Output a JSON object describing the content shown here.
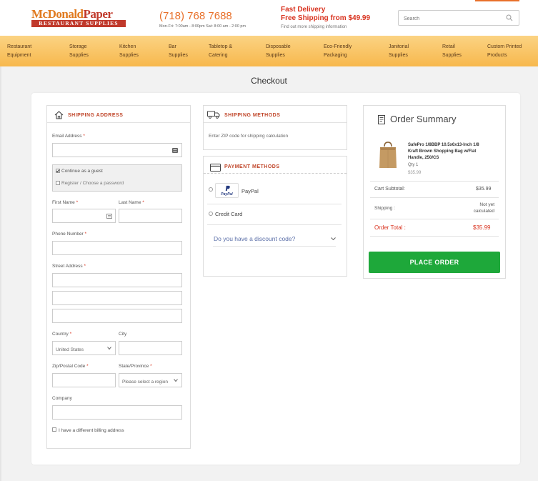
{
  "header": {
    "logo_top_left": "McDonald",
    "logo_top_right": "Paper",
    "logo_bottom": "RESTAURANT SUPPLIES",
    "phone": "(718) 768 7688",
    "hours": "Mon-Fri: 7:00am - 8:00pm Sat: 8:00 am - 2:00 pm",
    "fast_delivery": "Fast Delivery",
    "free_shipping": "Free Shipping from $49.99",
    "find_out": "Find out more shipping information",
    "search_placeholder": "Search"
  },
  "nav": [
    {
      "line1": "Restaurant",
      "line2": "Equipment"
    },
    {
      "line1": "Storage",
      "line2": "Supplies"
    },
    {
      "line1": "Kitchen",
      "line2": "Supplies"
    },
    {
      "line1": "Bar",
      "line2": "Supplies"
    },
    {
      "line1": "Tabletop &",
      "line2": "Catering"
    },
    {
      "line1": "Disposable",
      "line2": "Supplies"
    },
    {
      "line1": "Eco-Friendly",
      "line2": "Packaging"
    },
    {
      "line1": "Janitorial",
      "line2": "Supplies"
    },
    {
      "line1": "Retail",
      "line2": "Supplies"
    },
    {
      "line1": "Custom Printed",
      "line2": "Products"
    }
  ],
  "page_title": "Checkout",
  "shipping_address": {
    "title": "SHIPPING ADDRESS",
    "email_label": "Email Address",
    "continue_guest": "Continue as a guest",
    "register": "Register / Choose a password",
    "first_name": "First Name",
    "last_name": "Last Name",
    "phone": "Phone Number",
    "street": "Street Address",
    "country": "Country",
    "country_value": "United States",
    "city": "City",
    "zip": "Zip/Postal Code",
    "state": "State/Province",
    "state_placeholder": "Please select a region",
    "company": "Company",
    "billing": "I have a different billing address",
    "required_mark": "*"
  },
  "shipping_methods": {
    "title": "SHIPPING METHODS",
    "hint": "Enter ZIP code for shipping calculation"
  },
  "payment_methods": {
    "title": "PAYMENT METHODS",
    "paypal_logo": "PayPal",
    "paypal": "PayPal",
    "credit_card": "Credit Card",
    "discount": "Do you have a discount code?"
  },
  "order_summary": {
    "title": "Order Summary",
    "product_name_1": "SafePro 1/8BBP 10.5x6x13-Inch 1/8",
    "product_name_2": "Kraft Brown Shopping Bag w/Flat",
    "product_name_3": "Handle, 250/CS",
    "qty": "Qty 1",
    "price": "$35.99",
    "cart_subtotal_label": "Cart Subtotal:",
    "cart_subtotal": "$35.99",
    "shipping_label": "Shipping :",
    "shipping_value_1": "Not yet",
    "shipping_value_2": "calculated",
    "order_total_label": "Order Total :",
    "order_total": "$35.99",
    "place_order": "PLACE ORDER"
  },
  "colors": {
    "accent_orange": "#e8702a",
    "accent_red": "#c0462a",
    "nav_bg": "#f7b84d",
    "place_order_green": "#1ea83a"
  }
}
